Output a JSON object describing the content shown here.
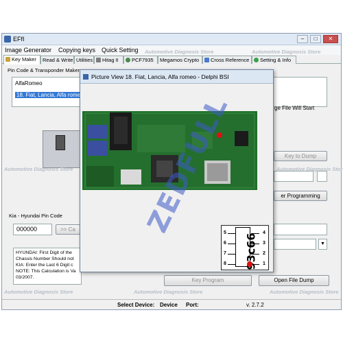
{
  "window": {
    "title": "EFfI"
  },
  "menu": [
    "Image Generator",
    "Copying keys",
    "Quick Setting"
  ],
  "tabs": [
    {
      "label": "Key Maker",
      "icon": "key-icon"
    },
    {
      "label": "Read & Write",
      "icon": ""
    },
    {
      "label": "Utilities",
      "icon": ""
    },
    {
      "label": "Hitag II",
      "icon": "chip-icon"
    },
    {
      "label": "PCF7935",
      "icon": "chip-icon"
    },
    {
      "label": "Megamos Crypto",
      "icon": ""
    },
    {
      "label": "Cross Reference",
      "icon": "arrows-icon"
    },
    {
      "label": "Setting & Info",
      "icon": "gear-icon"
    }
  ],
  "watermark": "Automotive Diagnosis Store",
  "keymaker": {
    "group_title": "Pin Code & Transponder Maker",
    "brand": "AlfaRomeo",
    "selected_item": "18. Fiat, Lancia, Alfa romeo",
    "note_suffix": "ge File Will Start",
    "key_to_dump": "Key to Dump",
    "programming_btn": "er Programming"
  },
  "kia": {
    "group_title": "Kia - Hyundai Pin Code",
    "code_value": "000000",
    "calc_btn": ">> Ca",
    "info_lines": [
      "HYUNDAI: First Digit of the",
      "Chassis Number Should not",
      "KIA: Enter the Last 6 Digit c",
      "NOTE: This Calculation is Va",
      "03/2007."
    ]
  },
  "buttons": {
    "key_program": "Key Program",
    "open_file_dump": "Open File Dump"
  },
  "status": {
    "select_device": "Select Device:",
    "device": "Device",
    "port": "Port:",
    "version": "v. 2.7.2"
  },
  "picture_view": {
    "title": "Picture View  18. Fiat, Lancia, Alfa romeo - Delphi BSI",
    "chip_marking": "93c66",
    "pins_left": [
      "5",
      "6",
      "7",
      "8"
    ],
    "pins_right": [
      "4",
      "3",
      "2",
      "1"
    ],
    "overlay": "ZEDFULL"
  },
  "colors": {
    "accent": "#3a66a8",
    "pcb": "#1f6e2a",
    "red": "#e01010"
  }
}
